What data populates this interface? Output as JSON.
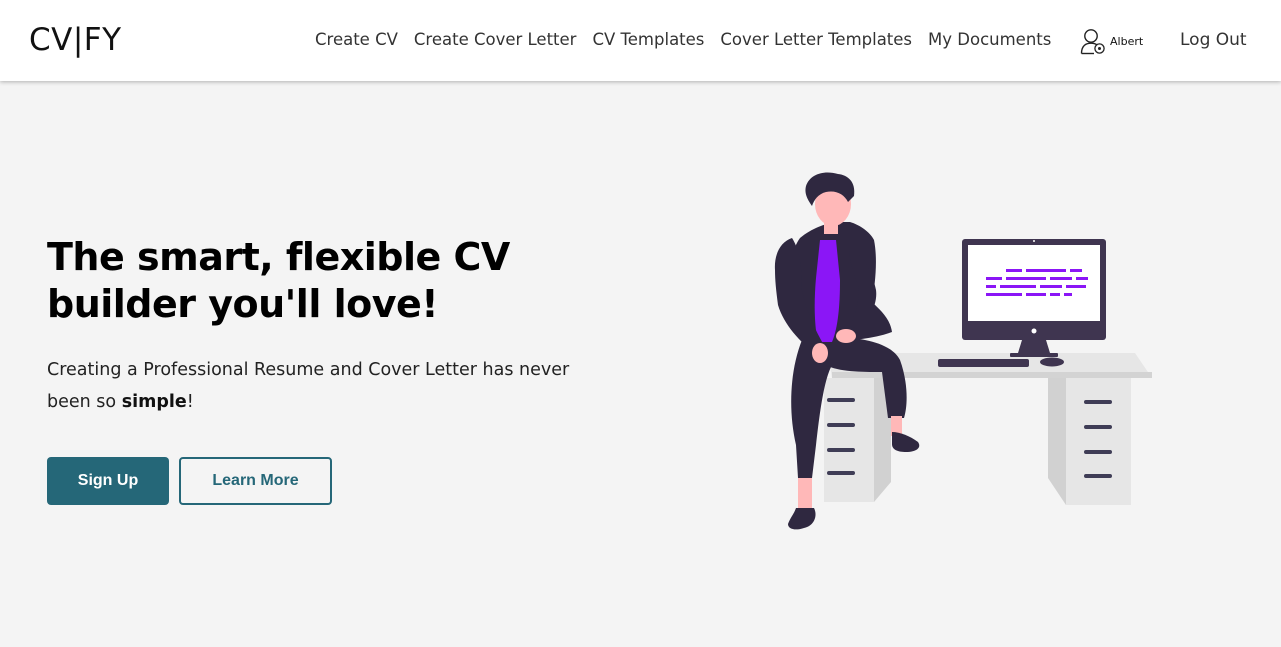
{
  "nav": {
    "logo": "CV|FY",
    "links": [
      "Create CV",
      "Create Cover Letter",
      "CV Templates",
      "Cover Letter Templates",
      "My Documents"
    ],
    "user_name": "Albert",
    "user_icon": "user-settings-icon",
    "logout_label": "Log Out"
  },
  "hero": {
    "title": "The smart, flexible CV builder you'll love!",
    "subtitle_before": "Creating a Professional Resume and Cover Letter has never been so ",
    "subtitle_emphasis": "simple",
    "subtitle_after": "!",
    "signup_label": "Sign Up",
    "learn_more_label": "Learn More"
  },
  "colors": {
    "accent": "#256778",
    "illustration_highlight": "#8b16f6",
    "illustration_dark": "#2f2840",
    "background": "#f4f4f4"
  }
}
